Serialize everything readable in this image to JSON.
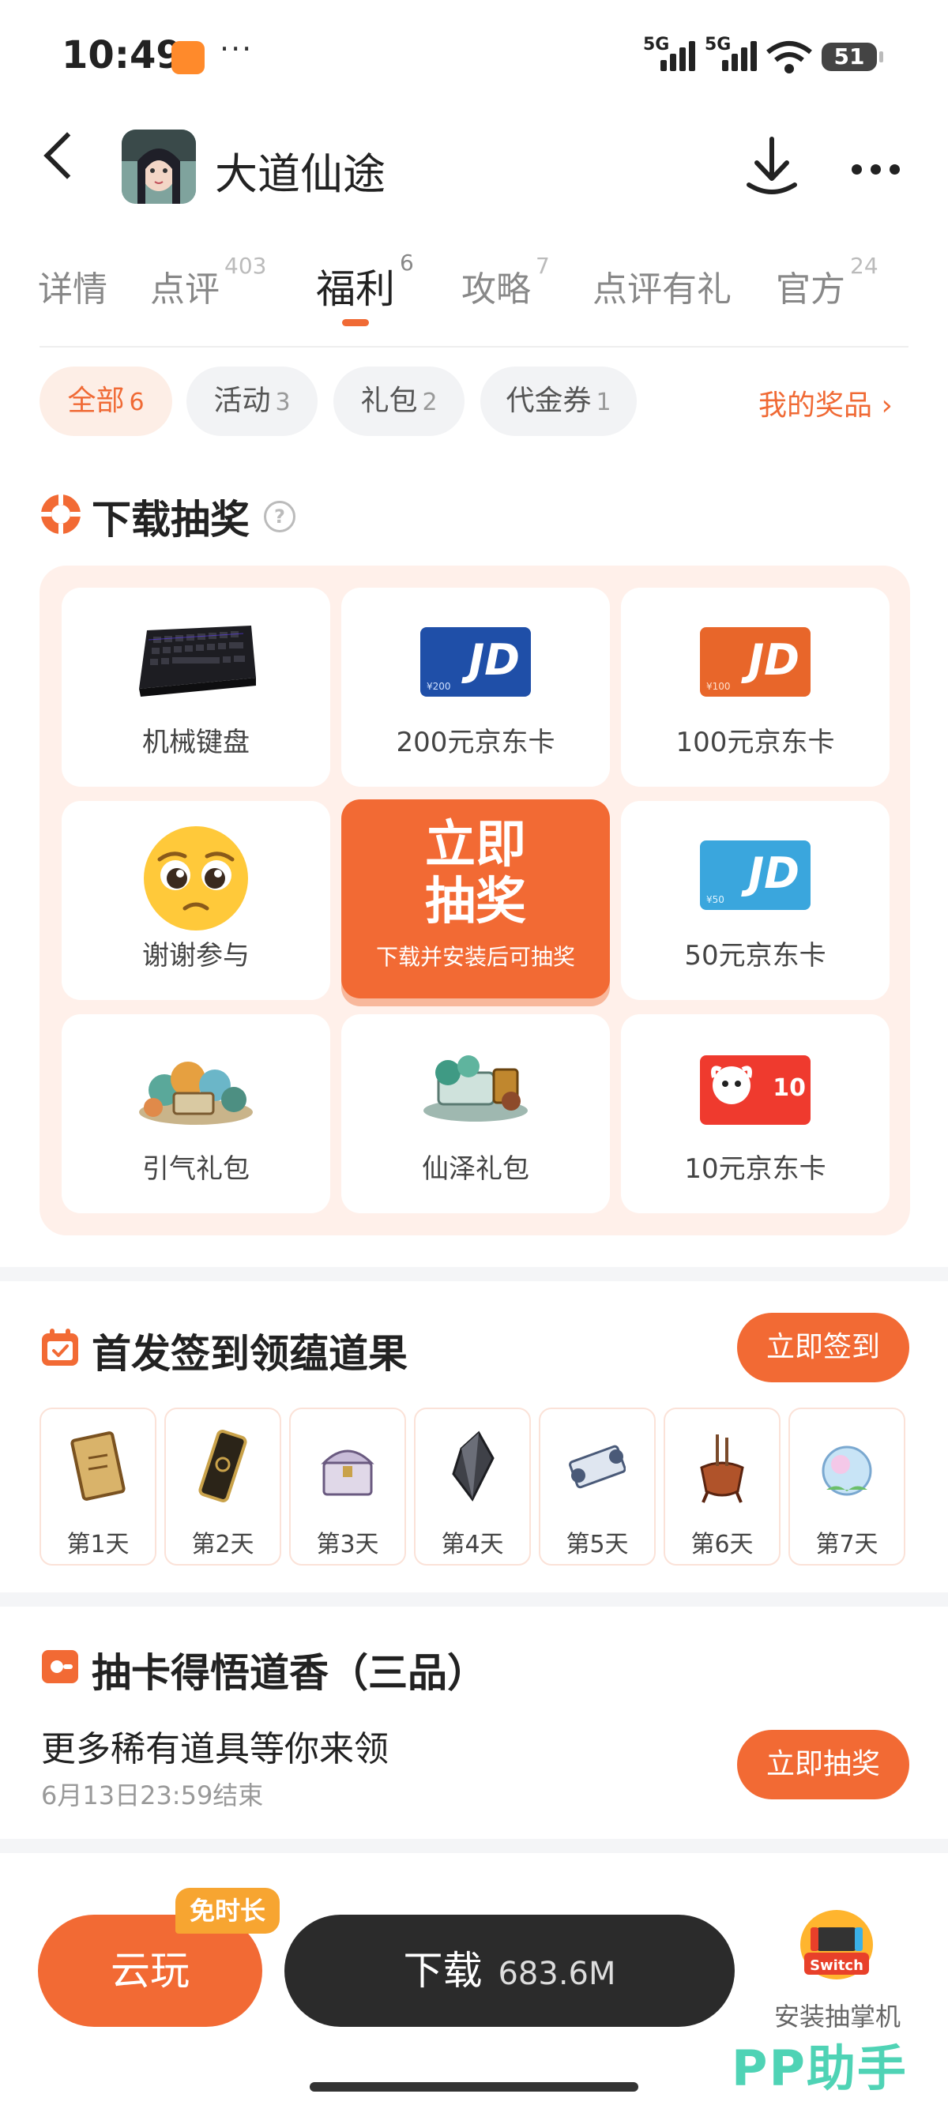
{
  "status_bar": {
    "time": "10:49",
    "dots": "···",
    "signal1": "5G",
    "signal2": "5G",
    "battery": "51"
  },
  "header": {
    "title": "大道仙途"
  },
  "tabs": [
    {
      "label": "详情",
      "count": ""
    },
    {
      "label": "点评",
      "count": "403"
    },
    {
      "label": "福利",
      "count": "6"
    },
    {
      "label": "攻略",
      "count": "7"
    },
    {
      "label": "点评有礼",
      "count": ""
    },
    {
      "label": "官方",
      "count": "24"
    }
  ],
  "filters": [
    {
      "label": "全部",
      "count": "6"
    },
    {
      "label": "活动",
      "count": "3"
    },
    {
      "label": "礼包",
      "count": "2"
    },
    {
      "label": "代金券",
      "count": "1"
    }
  ],
  "my_prizes": "我的奖品 ›",
  "lottery": {
    "title": "下载抽奖",
    "help": "?",
    "prizes": [
      "机械键盘",
      "200元京东卡",
      "100元京东卡",
      "谢谢参与",
      "50元京东卡",
      "引气礼包",
      "仙泽礼包",
      "10元京东卡"
    ],
    "draw_title": "立即抽奖",
    "draw_subtitle": "下载并安装后可抽奖",
    "card_text": {
      "jd": "JD",
      "c200": "¥200",
      "c100": "¥100",
      "c50": "¥50",
      "c10": "10"
    }
  },
  "signin": {
    "title": "首发签到领蕴道果",
    "button": "立即签到",
    "days": [
      "第1天",
      "第2天",
      "第3天",
      "第4天",
      "第5天",
      "第6天",
      "第7天"
    ]
  },
  "card_draw": {
    "title": "抽卡得悟道香（三品）",
    "desc": "更多稀有道具等你来领",
    "deadline": "6月13日23:59结束",
    "button": "立即抽奖"
  },
  "bottom": {
    "cloud_play": "云玩",
    "free_badge": "免时长",
    "download": "下载",
    "size": "683.6M",
    "promo_label": "安装抽掌机",
    "promo_switch": "Switch",
    "brand": "PP助手"
  }
}
